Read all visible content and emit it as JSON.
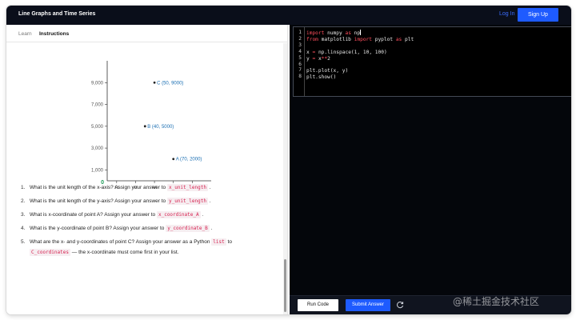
{
  "topbar": {
    "title": "Line Graphs and Time Series",
    "login": "Log In",
    "signup": "Sign Up"
  },
  "tabs": [
    {
      "label": "Learn"
    },
    {
      "label": "Instructions"
    }
  ],
  "chart_data": {
    "type": "scatter",
    "x_ticks": [
      "10",
      "30",
      "50",
      "70",
      "90"
    ],
    "y_ticks": [
      "1,000",
      "3,000",
      "5,000",
      "7,000",
      "9,000"
    ],
    "origin_label": "0",
    "points": [
      {
        "label": "C (50, 9000)",
        "x": 50,
        "y": 9000
      },
      {
        "label": "B (40, 5000)",
        "x": 40,
        "y": 5000
      },
      {
        "label": "A (70, 2000)",
        "x": 70,
        "y": 2000
      }
    ],
    "xlim": [
      0,
      110
    ],
    "ylim": [
      0,
      11000
    ],
    "point_color": "#222222",
    "label_color": "#1b6fb3"
  },
  "questions": [
    {
      "num": "1.",
      "text": "What is the unit length of the x-axis? Assign your answer to",
      "code": "x_unit_length",
      "after": "."
    },
    {
      "num": "2.",
      "text": "What is the unit length of the y-axis? Assign your answer to",
      "code": "y_unit_length",
      "after": "."
    },
    {
      "num": "3.",
      "text": "What is x-coordinate of point A? Assign your answer to",
      "code": "x_coordinate_A",
      "after": "."
    },
    {
      "num": "4.",
      "text": "What is the y-coordinate of point B? Assign your answer to",
      "code": "y_coordinate_B",
      "after": "."
    },
    {
      "num": "5.",
      "text": "What are the x- and y-coordinates of point C? Assign your answer as a Python",
      "code": "list",
      "after": "to",
      "code2": "C_coordinates",
      "after2": "— the x-coordinate must come first in your list."
    }
  ],
  "editor": {
    "line_numbers": [
      "1",
      "2",
      "3",
      "4",
      "5",
      "6",
      "7",
      "8"
    ],
    "lines": [
      "import numpy as np",
      "from matplotlib import pyplot as plt",
      "",
      "x = np.linspace(1, 10, 100)",
      "y = x**2",
      "",
      "plt.plot(x, y)",
      "plt.show()"
    ]
  },
  "buttons": {
    "run": "Run Code",
    "submit": "Submit Answer"
  },
  "watermark": "@稀土掘金技术社区"
}
